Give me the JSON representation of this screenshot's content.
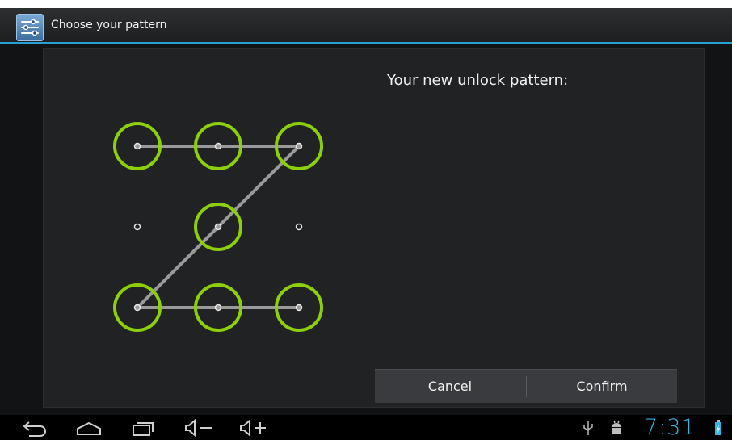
{
  "header": {
    "title": "Choose your pattern",
    "app_icon": "settings-sliders-icon"
  },
  "pattern": {
    "heading": "Your new unlock pattern:",
    "grid_size": 3,
    "selected_sequence": [
      1,
      2,
      3,
      5,
      7,
      8,
      9
    ],
    "accent_color": "#8ccf0a"
  },
  "buttons": {
    "cancel": "Cancel",
    "confirm": "Confirm"
  },
  "statusbar": {
    "time": "7:31",
    "icons": [
      "usb-icon",
      "android-debug-icon",
      "battery-charging-icon"
    ],
    "time_color": "#33b5e5"
  },
  "navbar": {
    "icons": [
      "back-icon",
      "home-icon",
      "recent-apps-icon",
      "volume-down-icon",
      "volume-up-icon"
    ]
  }
}
